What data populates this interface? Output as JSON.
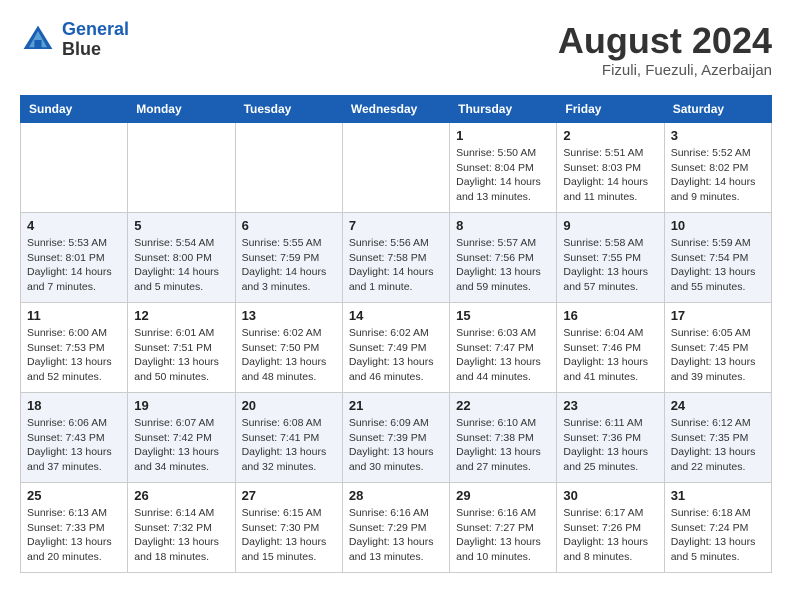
{
  "header": {
    "logo_line1": "General",
    "logo_line2": "Blue",
    "month": "August 2024",
    "location": "Fizuli, Fuezuli, Azerbaijan"
  },
  "weekdays": [
    "Sunday",
    "Monday",
    "Tuesday",
    "Wednesday",
    "Thursday",
    "Friday",
    "Saturday"
  ],
  "weeks": [
    [
      {
        "day": "",
        "info": ""
      },
      {
        "day": "",
        "info": ""
      },
      {
        "day": "",
        "info": ""
      },
      {
        "day": "",
        "info": ""
      },
      {
        "day": "1",
        "info": "Sunrise: 5:50 AM\nSunset: 8:04 PM\nDaylight: 14 hours\nand 13 minutes."
      },
      {
        "day": "2",
        "info": "Sunrise: 5:51 AM\nSunset: 8:03 PM\nDaylight: 14 hours\nand 11 minutes."
      },
      {
        "day": "3",
        "info": "Sunrise: 5:52 AM\nSunset: 8:02 PM\nDaylight: 14 hours\nand 9 minutes."
      }
    ],
    [
      {
        "day": "4",
        "info": "Sunrise: 5:53 AM\nSunset: 8:01 PM\nDaylight: 14 hours\nand 7 minutes."
      },
      {
        "day": "5",
        "info": "Sunrise: 5:54 AM\nSunset: 8:00 PM\nDaylight: 14 hours\nand 5 minutes."
      },
      {
        "day": "6",
        "info": "Sunrise: 5:55 AM\nSunset: 7:59 PM\nDaylight: 14 hours\nand 3 minutes."
      },
      {
        "day": "7",
        "info": "Sunrise: 5:56 AM\nSunset: 7:58 PM\nDaylight: 14 hours\nand 1 minute."
      },
      {
        "day": "8",
        "info": "Sunrise: 5:57 AM\nSunset: 7:56 PM\nDaylight: 13 hours\nand 59 minutes."
      },
      {
        "day": "9",
        "info": "Sunrise: 5:58 AM\nSunset: 7:55 PM\nDaylight: 13 hours\nand 57 minutes."
      },
      {
        "day": "10",
        "info": "Sunrise: 5:59 AM\nSunset: 7:54 PM\nDaylight: 13 hours\nand 55 minutes."
      }
    ],
    [
      {
        "day": "11",
        "info": "Sunrise: 6:00 AM\nSunset: 7:53 PM\nDaylight: 13 hours\nand 52 minutes."
      },
      {
        "day": "12",
        "info": "Sunrise: 6:01 AM\nSunset: 7:51 PM\nDaylight: 13 hours\nand 50 minutes."
      },
      {
        "day": "13",
        "info": "Sunrise: 6:02 AM\nSunset: 7:50 PM\nDaylight: 13 hours\nand 48 minutes."
      },
      {
        "day": "14",
        "info": "Sunrise: 6:02 AM\nSunset: 7:49 PM\nDaylight: 13 hours\nand 46 minutes."
      },
      {
        "day": "15",
        "info": "Sunrise: 6:03 AM\nSunset: 7:47 PM\nDaylight: 13 hours\nand 44 minutes."
      },
      {
        "day": "16",
        "info": "Sunrise: 6:04 AM\nSunset: 7:46 PM\nDaylight: 13 hours\nand 41 minutes."
      },
      {
        "day": "17",
        "info": "Sunrise: 6:05 AM\nSunset: 7:45 PM\nDaylight: 13 hours\nand 39 minutes."
      }
    ],
    [
      {
        "day": "18",
        "info": "Sunrise: 6:06 AM\nSunset: 7:43 PM\nDaylight: 13 hours\nand 37 minutes."
      },
      {
        "day": "19",
        "info": "Sunrise: 6:07 AM\nSunset: 7:42 PM\nDaylight: 13 hours\nand 34 minutes."
      },
      {
        "day": "20",
        "info": "Sunrise: 6:08 AM\nSunset: 7:41 PM\nDaylight: 13 hours\nand 32 minutes."
      },
      {
        "day": "21",
        "info": "Sunrise: 6:09 AM\nSunset: 7:39 PM\nDaylight: 13 hours\nand 30 minutes."
      },
      {
        "day": "22",
        "info": "Sunrise: 6:10 AM\nSunset: 7:38 PM\nDaylight: 13 hours\nand 27 minutes."
      },
      {
        "day": "23",
        "info": "Sunrise: 6:11 AM\nSunset: 7:36 PM\nDaylight: 13 hours\nand 25 minutes."
      },
      {
        "day": "24",
        "info": "Sunrise: 6:12 AM\nSunset: 7:35 PM\nDaylight: 13 hours\nand 22 minutes."
      }
    ],
    [
      {
        "day": "25",
        "info": "Sunrise: 6:13 AM\nSunset: 7:33 PM\nDaylight: 13 hours\nand 20 minutes."
      },
      {
        "day": "26",
        "info": "Sunrise: 6:14 AM\nSunset: 7:32 PM\nDaylight: 13 hours\nand 18 minutes."
      },
      {
        "day": "27",
        "info": "Sunrise: 6:15 AM\nSunset: 7:30 PM\nDaylight: 13 hours\nand 15 minutes."
      },
      {
        "day": "28",
        "info": "Sunrise: 6:16 AM\nSunset: 7:29 PM\nDaylight: 13 hours\nand 13 minutes."
      },
      {
        "day": "29",
        "info": "Sunrise: 6:16 AM\nSunset: 7:27 PM\nDaylight: 13 hours\nand 10 minutes."
      },
      {
        "day": "30",
        "info": "Sunrise: 6:17 AM\nSunset: 7:26 PM\nDaylight: 13 hours\nand 8 minutes."
      },
      {
        "day": "31",
        "info": "Sunrise: 6:18 AM\nSunset: 7:24 PM\nDaylight: 13 hours\nand 5 minutes."
      }
    ]
  ]
}
